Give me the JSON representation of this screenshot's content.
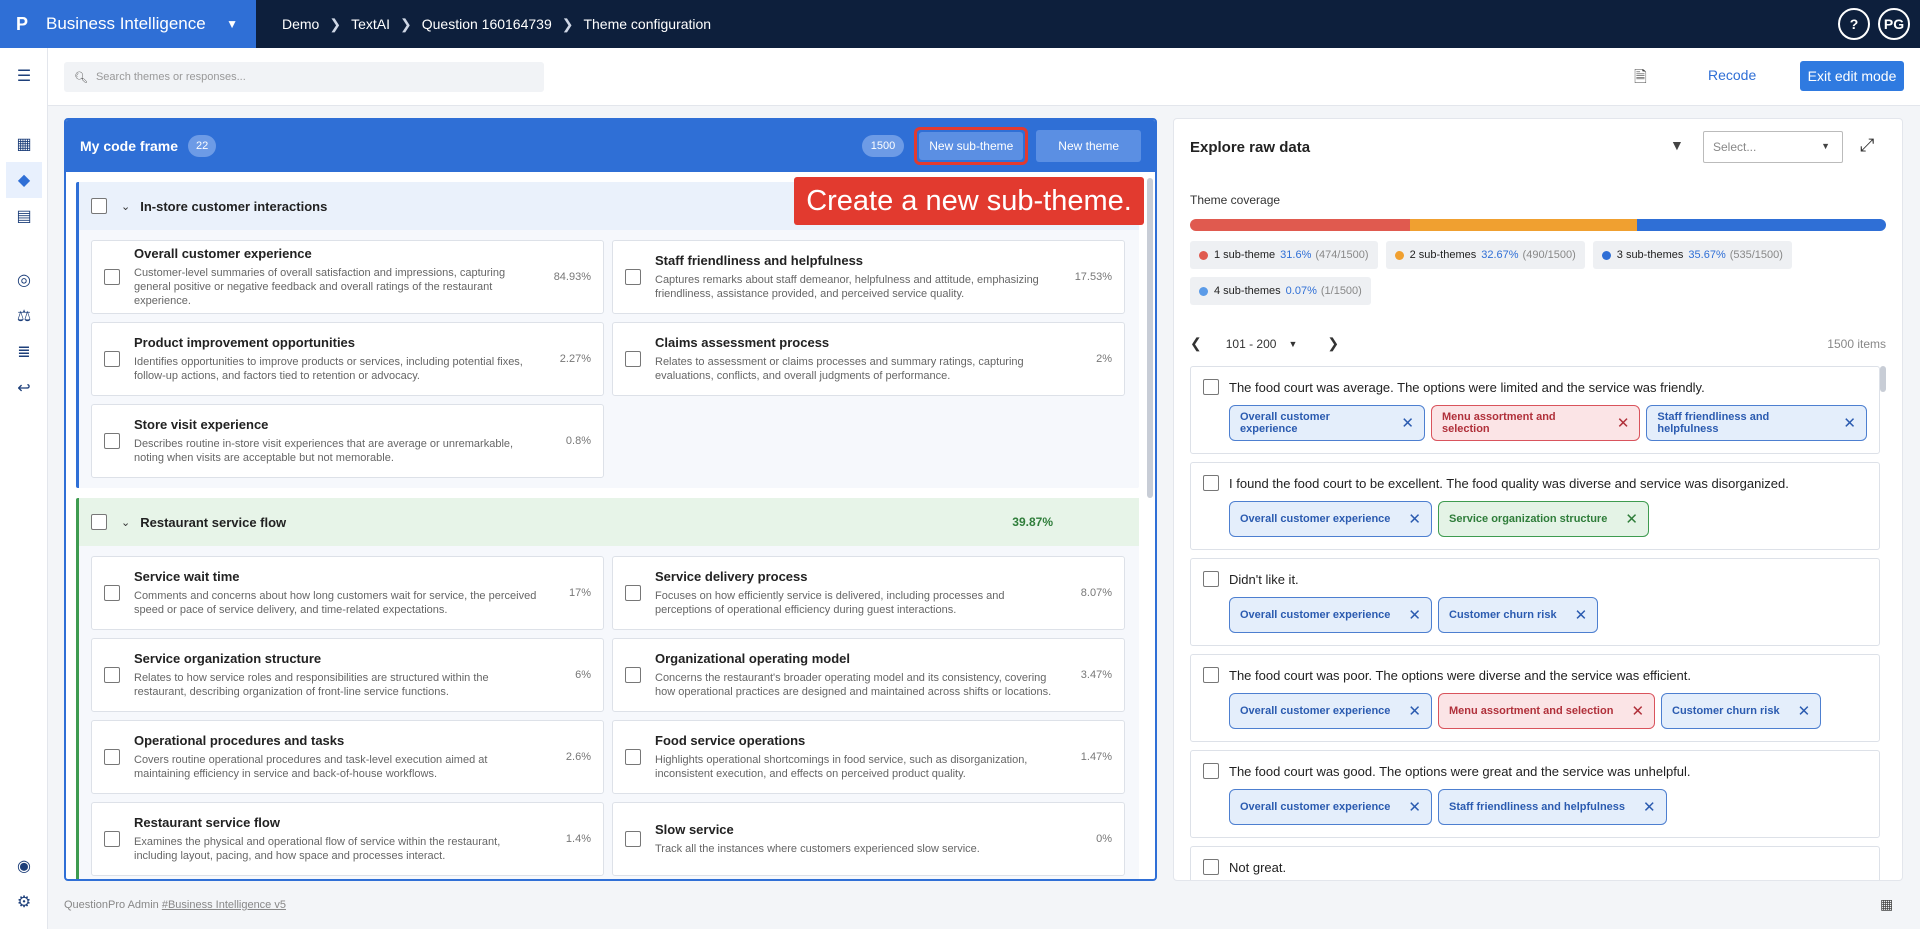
{
  "app": {
    "logo": "P",
    "title": "Business Intelligence"
  },
  "breadcrumbs": [
    "Demo",
    "TextAI",
    "Question 160164739",
    "Theme configuration"
  ],
  "topright": {
    "help": "?",
    "avatar": "PG"
  },
  "toolbar": {
    "search_placeholder": "Search themes or responses...",
    "recode": "Recode",
    "exit": "Exit edit mode"
  },
  "codeframe": {
    "title": "My code frame",
    "count": "22",
    "total": "1500",
    "new_subtheme": "New sub-theme",
    "new_theme": "New theme",
    "groups": [
      {
        "title": "In-store customer interactions",
        "pct": "",
        "cards": [
          {
            "title": "Overall customer experience",
            "desc": "Customer-level summaries of overall satisfaction and impressions, capturing general positive or negative feedback and overall ratings of the restaurant experience.",
            "pct": "84.93%"
          },
          {
            "title": "Staff friendliness and helpfulness",
            "desc": "Captures remarks about staff demeanor, helpfulness and attitude, emphasizing friendliness, assistance provided, and perceived service quality.",
            "pct": "17.53%"
          },
          {
            "title": "Product improvement opportunities",
            "desc": "Identifies opportunities to improve products or services, including potential fixes, follow-up actions, and factors tied to retention or advocacy.",
            "pct": "2.27%"
          },
          {
            "title": "Claims assessment process",
            "desc": "Relates to assessment or claims processes and summary ratings, capturing evaluations, conflicts, and overall judgments of performance.",
            "pct": "2%"
          },
          {
            "title": "Store visit experience",
            "desc": "Describes routine in-store visit experiences that are average or unremarkable, noting when visits are acceptable but not memorable.",
            "pct": "0.8%"
          }
        ]
      },
      {
        "title": "Restaurant service flow",
        "pct": "39.87%",
        "cards": [
          {
            "title": "Service wait time",
            "desc": "Comments and concerns about how long customers wait for service, the perceived speed or pace of service delivery, and time-related expectations.",
            "pct": "17%"
          },
          {
            "title": "Service delivery process",
            "desc": "Focuses on how efficiently service is delivered, including processes and perceptions of operational efficiency during guest interactions.",
            "pct": "8.07%"
          },
          {
            "title": "Service organization structure",
            "desc": "Relates to how service roles and responsibilities are structured within the restaurant, describing organization of front-line service functions.",
            "pct": "6%"
          },
          {
            "title": "Organizational operating model",
            "desc": "Concerns the restaurant's broader operating model and its consistency, covering how operational practices are designed and maintained across shifts or locations.",
            "pct": "3.47%"
          },
          {
            "title": "Operational procedures and tasks",
            "desc": "Covers routine operational procedures and task-level execution aimed at maintaining efficiency in service and back-of-house workflows.",
            "pct": "2.6%"
          },
          {
            "title": "Food service operations",
            "desc": "Highlights operational shortcomings in food service, such as disorganization, inconsistent execution, and effects on perceived product quality.",
            "pct": "1.47%"
          },
          {
            "title": "Restaurant service flow",
            "desc": "Examines the physical and operational flow of service within the restaurant, including layout, pacing, and how space and processes interact.",
            "pct": "1.4%"
          },
          {
            "title": "Slow service",
            "desc": "Track all the instances where customers experienced slow service.",
            "pct": "0%"
          }
        ]
      }
    ]
  },
  "annotation": "Create a new sub-theme.",
  "explore": {
    "title": "Explore raw data",
    "select_placeholder": "Select...",
    "coverage_label": "Theme coverage",
    "coverage": [
      {
        "label": "1 sub-theme",
        "pct": "31.6%",
        "frac": "(474/1500)",
        "color": "#e05a4f",
        "value": 31.6
      },
      {
        "label": "2 sub-themes",
        "pct": "32.67%",
        "frac": "(490/1500)",
        "color": "#f0a030",
        "value": 32.67
      },
      {
        "label": "3 sub-themes",
        "pct": "35.67%",
        "frac": "(535/1500)",
        "color": "#2f6fd6",
        "value": 35.67
      },
      {
        "label": "4 sub-themes",
        "pct": "0.07%",
        "frac": "(1/1500)",
        "color": "#5b9be8",
        "value": 0.07
      }
    ],
    "range": "101 - 200",
    "items": "1500 items",
    "responses": [
      {
        "text": "The food court was average. The options were limited and the service was friendly.",
        "tags": [
          {
            "label": "Overall customer experience",
            "kind": "blue"
          },
          {
            "label": "Menu assortment and selection",
            "kind": "red"
          },
          {
            "label": "Staff friendliness and helpfulness",
            "kind": "blue"
          }
        ]
      },
      {
        "text": "I found the food court to be excellent. The food quality was diverse and service was disorganized.",
        "tags": [
          {
            "label": "Overall customer experience",
            "kind": "blue"
          },
          {
            "label": "Service organization structure",
            "kind": "green"
          }
        ]
      },
      {
        "text": "Didn't like it.",
        "tags": [
          {
            "label": "Overall customer experience",
            "kind": "blue"
          },
          {
            "label": "Customer churn risk",
            "kind": "blue"
          }
        ]
      },
      {
        "text": "The food court was poor. The options were diverse and the service was efficient.",
        "tags": [
          {
            "label": "Overall customer experience",
            "kind": "blue"
          },
          {
            "label": "Menu assortment and selection",
            "kind": "red"
          },
          {
            "label": "Customer churn risk",
            "kind": "blue"
          }
        ]
      },
      {
        "text": "The food court was good. The options were great and the service was unhelpful.",
        "tags": [
          {
            "label": "Overall customer experience",
            "kind": "blue"
          },
          {
            "label": "Staff friendliness and helpfulness",
            "kind": "blue"
          }
        ]
      },
      {
        "text": "Not great.",
        "tags": []
      }
    ]
  },
  "footer": {
    "prefix": "QuestionPro Admin ",
    "link": "#Business Intelligence v5"
  }
}
